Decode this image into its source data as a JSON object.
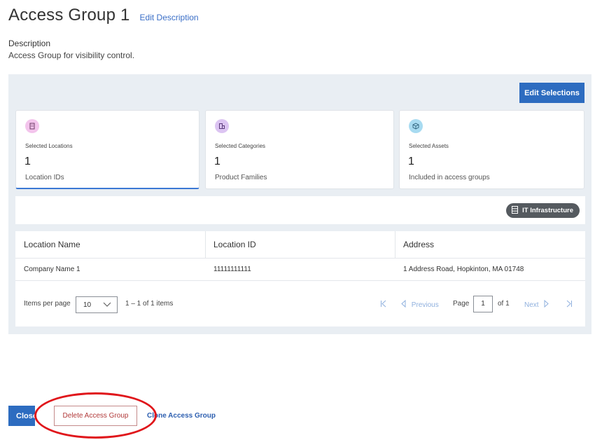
{
  "header": {
    "title": "Access Group 1",
    "edit_description": "Edit Description"
  },
  "description": {
    "label": "Description",
    "text": "Access Group for visibility control."
  },
  "panel": {
    "edit_selections": "Edit Selections",
    "cards": [
      {
        "label": "Selected Locations",
        "count": "1",
        "sub": "Location IDs",
        "icon": "location-icon",
        "color": "#f3c4ec",
        "active": true
      },
      {
        "label": "Selected Categories",
        "count": "1",
        "sub": "Product Families",
        "icon": "category-icon",
        "color": "#dcc4f2",
        "active": false
      },
      {
        "label": "Selected Assets",
        "count": "1",
        "sub": "Included in access groups",
        "icon": "cube-icon",
        "color": "#a8dbf1",
        "active": false
      }
    ],
    "tag": {
      "label": "IT Infrastructure",
      "icon": "server-icon"
    }
  },
  "table": {
    "headers": [
      "Location Name",
      "Location ID",
      "Address"
    ],
    "rows": [
      [
        "Company Name 1",
        "11111111111",
        "1 Address Road, Hopkinton, MA 01748"
      ]
    ]
  },
  "pager": {
    "items_per_page_label": "Items per page",
    "items_per_page": "10",
    "range": "1 – 1 of 1 items",
    "previous": "Previous",
    "page_label": "Page",
    "page": "1",
    "of": "of 1",
    "next": "Next"
  },
  "footer": {
    "close": "Close",
    "delete": "Delete Access Group",
    "clone": "Clone Access Group"
  },
  "colors": {
    "accent": "#2d6cc0",
    "danger": "#b23a3a",
    "annotation": "#e0161b"
  }
}
